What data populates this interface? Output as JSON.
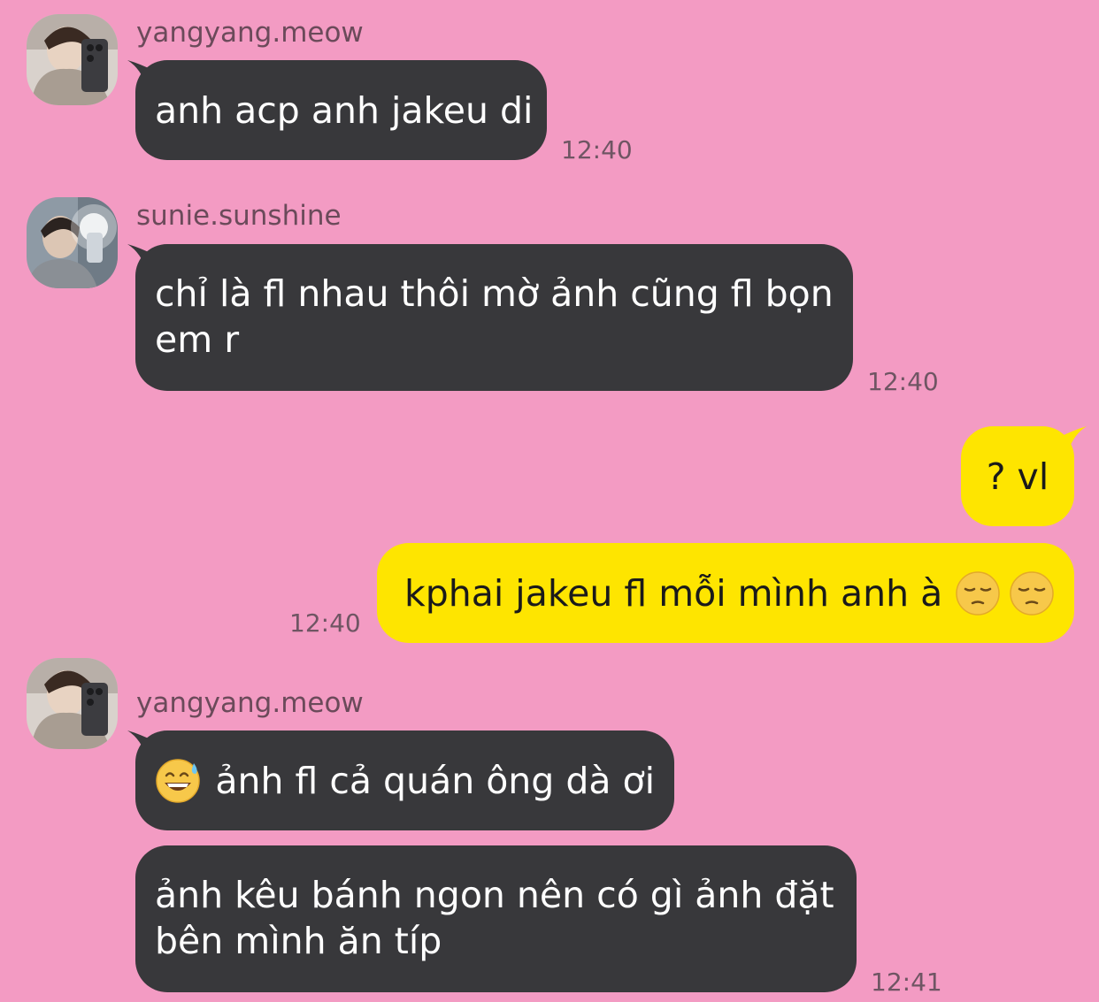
{
  "conversation": {
    "messages": [
      {
        "sender": "yangyang.meow",
        "text": "anh acp anh jakeu di",
        "time": "12:40"
      },
      {
        "sender": "sunie.sunshine",
        "lines": [
          "chỉ là fl nhau thôi mờ ảnh cũng fl bọn",
          "em r"
        ],
        "time": "12:40"
      },
      {
        "own": true,
        "text": "? vl"
      },
      {
        "own": true,
        "text": "kphai jakeu fl mỗi mình anh à",
        "emojis": [
          "pensive-face",
          "pensive-face"
        ],
        "time": "12:40"
      },
      {
        "sender": "yangyang.meow",
        "emoji": "grinning-sweat-face",
        "text": "ảnh fl cả quán ông dà ơi"
      },
      {
        "lines": [
          "ảnh kêu bánh ngon nên có gì ảnh đặt",
          "bên mình ăn típ"
        ],
        "time": "12:41"
      }
    ]
  },
  "colors": {
    "background": "#f39bc3",
    "incoming_bubble": "#38383b",
    "outgoing_bubble": "#fee500"
  }
}
